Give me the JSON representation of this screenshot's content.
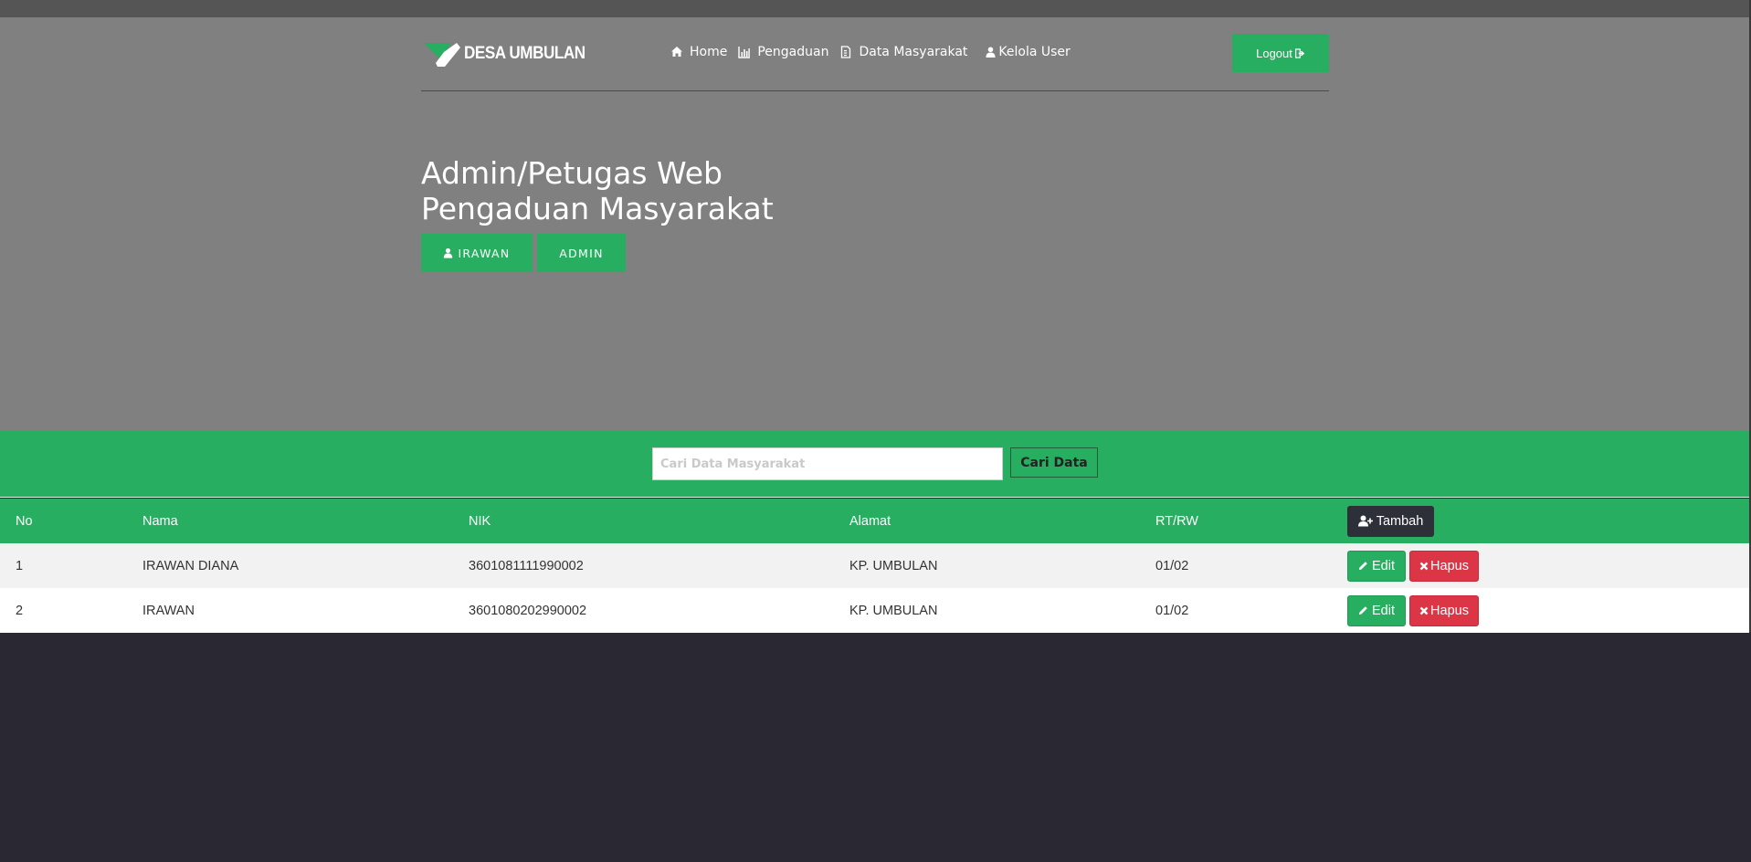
{
  "brand": {
    "name": "DESA UMBULAN",
    "logo_icon": "check-mark-logo"
  },
  "nav": [
    {
      "label": "Home",
      "icon": "home-icon"
    },
    {
      "label": "Pengaduan",
      "icon": "bar-chart-icon"
    },
    {
      "label": "Data Masyarakat",
      "icon": "document-icon"
    },
    {
      "label": "Kelola User",
      "icon": "user-icon"
    }
  ],
  "logout_label": "Logout",
  "hero": {
    "title_line1": "Admin/Petugas Web",
    "title_line2": "Pengaduan Masyarakat",
    "user_name": "IRAWAN",
    "role": "ADMIN"
  },
  "search": {
    "placeholder": "Cari Data Masyarakat",
    "button_label": "Cari Data"
  },
  "table": {
    "headers": {
      "no": "No",
      "nama": "Nama",
      "nik": "NIK",
      "alamat": "Alamat",
      "rtrw": "RT/RW"
    },
    "add_label": "Tambah",
    "edit_label": "Edit",
    "delete_label": "Hapus",
    "rows": [
      {
        "no": "1",
        "nama": "IRAWAN DIANA",
        "nik": "3601081111990002",
        "alamat": "KP. UMBULAN",
        "rtrw": "01/02"
      },
      {
        "no": "2",
        "nama": "IRAWAN",
        "nik": "3601080202990002",
        "alamat": "KP. UMBULAN",
        "rtrw": "01/02"
      }
    ]
  },
  "colors": {
    "accent_green": "#27ae60",
    "danger_red": "#dc3545",
    "dark_button": "#2d3039",
    "hero_gray": "#808080",
    "page_dark": "#2a2933"
  }
}
